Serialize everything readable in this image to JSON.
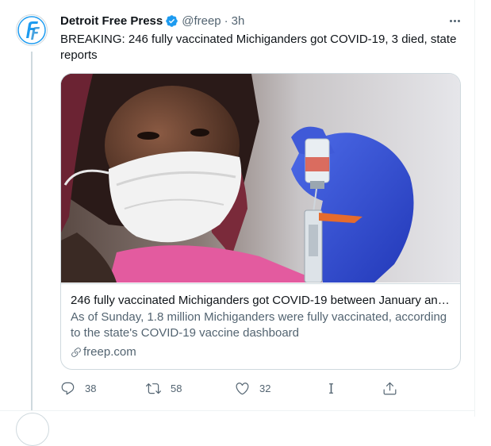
{
  "tweet": {
    "author_name": "Detroit Free Press",
    "handle": "@freep",
    "separator": "·",
    "time": "3h",
    "text": "BREAKING: 246 fully vaccinated Michiganders got COVID-19, 3 died, state reports"
  },
  "card": {
    "title": "246 fully vaccinated Michiganders got COVID-19 between January and ...",
    "description": "As of Sunday, 1.8 million Michiganders were fully vaccinated, according to the state's COVID-19 vaccine dashboard",
    "domain": "freep.com",
    "image_alt": "Healthcare worker in mask and blue gloves filling a syringe from a vaccine vial"
  },
  "actions": {
    "reply_count": "38",
    "retweet_count": "58",
    "like_count": "32"
  },
  "icons": {
    "avatar": "detroit-free-press-logo",
    "verified": "verified-badge-icon",
    "more": "more-icon",
    "link": "link-icon",
    "reply": "reply-icon",
    "retweet": "retweet-icon",
    "like": "like-icon",
    "ip": "ip-icon",
    "share": "share-icon"
  },
  "colors": {
    "accent": "#1d9bf0",
    "secondary_text": "#536471",
    "border": "#cfd9de"
  }
}
